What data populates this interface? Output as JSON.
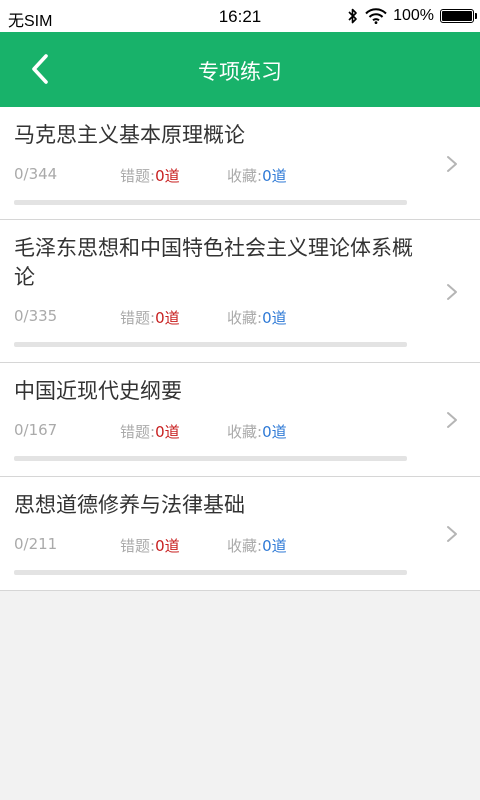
{
  "status_bar": {
    "carrier": "无SIM",
    "time": "16:21",
    "battery_percent": "100%",
    "battery_level": 1.0,
    "icons": [
      "bluetooth-icon",
      "wifi-icon",
      "battery-icon"
    ]
  },
  "nav": {
    "title": "专项练习",
    "back_icon": "chevron-left-icon"
  },
  "colors": {
    "primary": "#18b26a",
    "wrong_value": "#c82020",
    "favorite_value": "#2f7ad6"
  },
  "items": [
    {
      "title": "马克思主义基本原理概论",
      "progress": "0/344",
      "progress_fraction": 0,
      "wrong_label": "错题:",
      "wrong_value": "0道",
      "fav_label": "收藏:",
      "fav_value": "0道"
    },
    {
      "title": "毛泽东思想和中国特色社会主义理论体系概论",
      "progress": "0/335",
      "progress_fraction": 0,
      "wrong_label": "错题:",
      "wrong_value": "0道",
      "fav_label": "收藏:",
      "fav_value": "0道"
    },
    {
      "title": "中国近现代史纲要",
      "progress": "0/167",
      "progress_fraction": 0,
      "wrong_label": "错题:",
      "wrong_value": "0道",
      "fav_label": "收藏:",
      "fav_value": "0道"
    },
    {
      "title": "思想道德修养与法律基础",
      "progress": "0/211",
      "progress_fraction": 0,
      "wrong_label": "错题:",
      "wrong_value": "0道",
      "fav_label": "收藏:",
      "fav_value": "0道"
    }
  ]
}
